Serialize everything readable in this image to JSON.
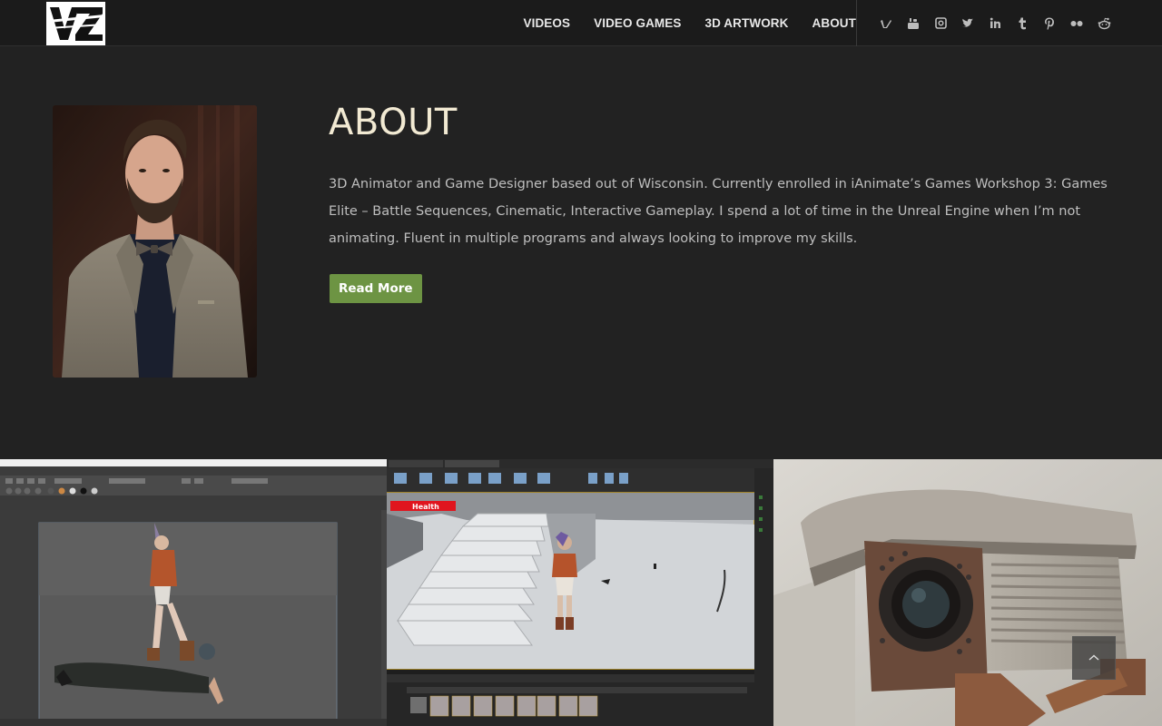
{
  "brand": {
    "logo_text": "VZ"
  },
  "nav": {
    "items": [
      "VIDEOS",
      "VIDEO GAMES",
      "3D ARTWORK",
      "ABOUT"
    ]
  },
  "social": [
    "vimeo-icon",
    "youtube-icon",
    "instagram-icon",
    "twitter-icon",
    "linkedin-icon",
    "tumblr-icon",
    "pinterest-icon",
    "flickr-icon",
    "reddit-icon"
  ],
  "about": {
    "title": "ABOUT",
    "text": "3D Animator and Game Designer based out of Wisconsin. Currently enrolled in iAnimate’s Games Workshop 3: Games Elite – Battle Sequences, Cinematic, Interactive Gameplay. I spend a lot of time in the Unreal Engine when I’m not animating. Fluent in multiple programs and always looking to improve my skills.",
    "button": "Read More"
  },
  "gallery": {
    "game_hud": {
      "health_label": "Health"
    }
  },
  "colors": {
    "background": "#222222",
    "header": "#1b1b1b",
    "accent_green": "#6d9443",
    "title": "#f2ead3"
  }
}
